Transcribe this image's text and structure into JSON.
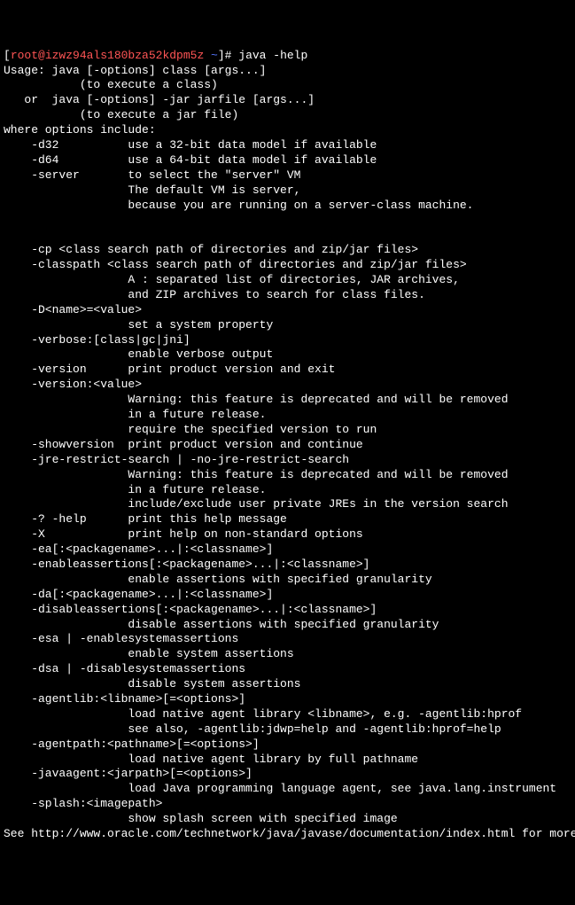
{
  "prompt": {
    "open": "[",
    "user": "root@izwz94als180bza52kdpm5z",
    "path": " ~",
    "close": "]# ",
    "cmd": "java -help"
  },
  "lines": [
    "Usage: java [-options] class [args...]",
    "           (to execute a class)",
    "   or  java [-options] -jar jarfile [args...]",
    "           (to execute a jar file)",
    "where options include:",
    "    -d32          use a 32-bit data model if available",
    "    -d64          use a 64-bit data model if available",
    "    -server       to select the \"server\" VM",
    "                  The default VM is server,",
    "                  because you are running on a server-class machine.",
    "",
    "",
    "    -cp <class search path of directories and zip/jar files>",
    "    -classpath <class search path of directories and zip/jar files>",
    "                  A : separated list of directories, JAR archives,",
    "                  and ZIP archives to search for class files.",
    "    -D<name>=<value>",
    "                  set a system property",
    "    -verbose:[class|gc|jni]",
    "                  enable verbose output",
    "    -version      print product version and exit",
    "    -version:<value>",
    "                  Warning: this feature is deprecated and will be removed",
    "                  in a future release.",
    "                  require the specified version to run",
    "    -showversion  print product version and continue",
    "    -jre-restrict-search | -no-jre-restrict-search",
    "                  Warning: this feature is deprecated and will be removed",
    "                  in a future release.",
    "                  include/exclude user private JREs in the version search",
    "    -? -help      print this help message",
    "    -X            print help on non-standard options",
    "    -ea[:<packagename>...|:<classname>]",
    "    -enableassertions[:<packagename>...|:<classname>]",
    "                  enable assertions with specified granularity",
    "    -da[:<packagename>...|:<classname>]",
    "    -disableassertions[:<packagename>...|:<classname>]",
    "                  disable assertions with specified granularity",
    "    -esa | -enablesystemassertions",
    "                  enable system assertions",
    "    -dsa | -disablesystemassertions",
    "                  disable system assertions",
    "    -agentlib:<libname>[=<options>]",
    "                  load native agent library <libname>, e.g. -agentlib:hprof",
    "                  see also, -agentlib:jdwp=help and -agentlib:hprof=help",
    "    -agentpath:<pathname>[=<options>]",
    "                  load native agent library by full pathname",
    "    -javaagent:<jarpath>[=<options>]",
    "                  load Java programming language agent, see java.lang.instrument",
    "    -splash:<imagepath>",
    "                  show splash screen with specified image",
    "See http://www.oracle.com/technetwork/java/javase/documentation/index.html for more details."
  ]
}
